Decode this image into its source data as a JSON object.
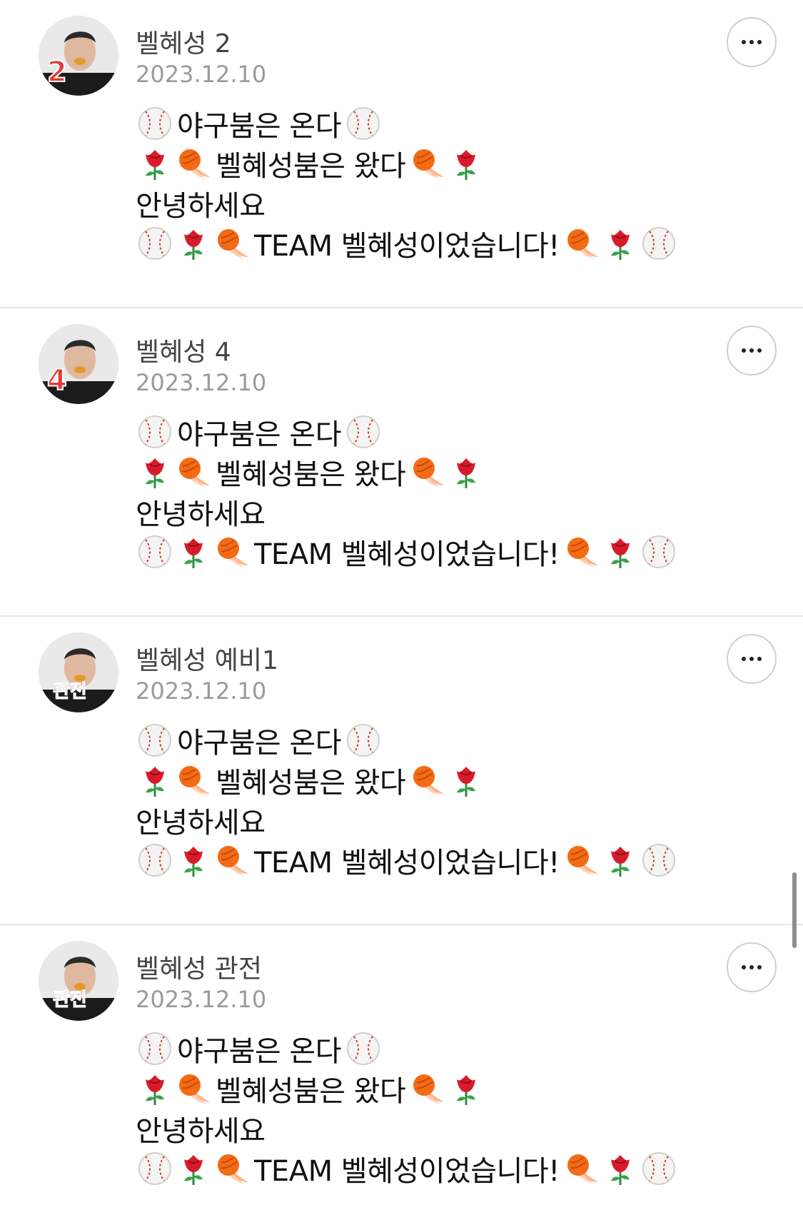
{
  "feed": {
    "posts": [
      {
        "author": "벨혜성 2",
        "date": "2023.12.10",
        "avatar_badge": "2",
        "lines": {
          "l1": "야구붐은 온다",
          "l2": "벨혜성붐은 왔다",
          "l3": "안녕하세요",
          "l4": "TEAM 벨혜성이었습니다!"
        }
      },
      {
        "author": "벨혜성 4",
        "date": "2023.12.10",
        "avatar_badge": "4",
        "lines": {
          "l1": "야구붐은 온다",
          "l2": "벨혜성붐은 왔다",
          "l3": "안녕하세요",
          "l4": "TEAM 벨혜성이었습니다!"
        }
      },
      {
        "author": "벨혜성 예비1",
        "date": "2023.12.10",
        "avatar_badge": "관전",
        "lines": {
          "l1": "야구붐은 온다",
          "l2": "벨혜성붐은 왔다",
          "l3": "안녕하세요",
          "l4": "TEAM 벨혜성이었습니다!"
        }
      },
      {
        "author": "벨혜성 관전",
        "date": "2023.12.10",
        "avatar_badge": "관전",
        "lines": {
          "l1": "야구붐은 온다",
          "l2": "벨혜성붐은 왔다",
          "l3": "안녕하세요",
          "l4": "TEAM 벨혜성이었습니다!"
        }
      }
    ]
  },
  "icons": {
    "more": "more-options-icon",
    "baseball": "baseball-icon",
    "rose": "rose-icon",
    "fireball": "fireball-icon"
  },
  "colors": {
    "name": "#444444",
    "date": "#9a9a9a",
    "text": "#111111",
    "divider": "#e6e6e6",
    "badge": "#e53935"
  }
}
